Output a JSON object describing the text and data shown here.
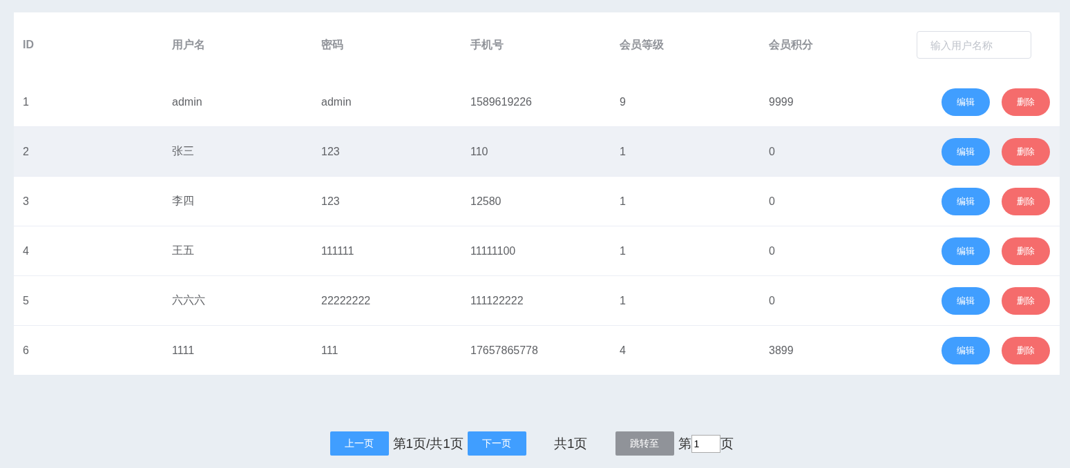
{
  "table": {
    "columns": [
      "ID",
      "用户名",
      "密码",
      "手机号",
      "会员等级",
      "会员积分"
    ],
    "search": {
      "placeholder": "输入用户名称"
    },
    "rows": [
      {
        "cells": [
          "1",
          "admin",
          "admin",
          "1589619226",
          "9",
          "9999"
        ],
        "highlighted": false,
        "actions": [
          "编辑",
          "删除"
        ]
      },
      {
        "cells": [
          "2",
          "张三",
          "123",
          "110",
          "1",
          "0"
        ],
        "highlighted": true,
        "actions": [
          "编辑",
          "删除"
        ]
      },
      {
        "cells": [
          "3",
          "李四",
          "123",
          "12580",
          "1",
          "0"
        ],
        "highlighted": false,
        "actions": [
          "编辑",
          "删除"
        ]
      },
      {
        "cells": [
          "4",
          "王五",
          "111111",
          "11111100",
          "1",
          "0"
        ],
        "highlighted": false,
        "actions": [
          "编辑",
          "删除"
        ]
      },
      {
        "cells": [
          "5",
          "六六六",
          "22222222",
          "111122222",
          "1",
          "0"
        ],
        "highlighted": false,
        "actions": [
          "编辑",
          "删除"
        ]
      },
      {
        "cells": [
          "6",
          "1111",
          "111",
          "17657865778",
          "4",
          "3899"
        ],
        "highlighted": false,
        "actions": [
          "编辑",
          "删除"
        ]
      }
    ]
  },
  "pagination": {
    "prev": "上一页",
    "status": "第1页/共1页",
    "next": "下一页",
    "total": "共1页",
    "jump": "跳转至",
    "page_prefix": "第",
    "page_value": "1",
    "page_suffix": "页"
  }
}
